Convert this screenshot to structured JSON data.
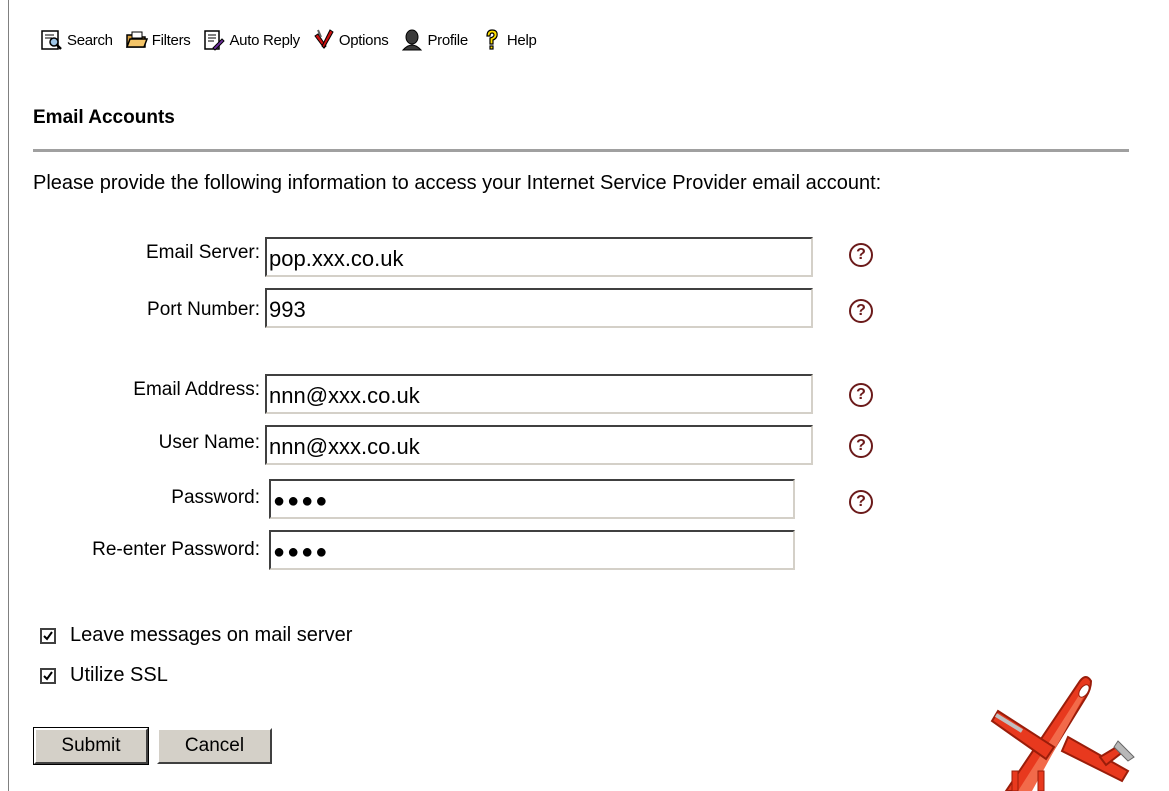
{
  "toolbar": {
    "items": [
      {
        "label": "Search",
        "icon": "search-icon"
      },
      {
        "label": "Filters",
        "icon": "filters-icon"
      },
      {
        "label": "Auto Reply",
        "icon": "auto-reply-icon"
      },
      {
        "label": "Options",
        "icon": "options-icon"
      },
      {
        "label": "Profile",
        "icon": "profile-icon"
      },
      {
        "label": "Help",
        "icon": "help-icon"
      }
    ]
  },
  "section": {
    "title": "Email Accounts",
    "intro": "Please provide the following information to access your Internet Service Provider email account:"
  },
  "form": {
    "email_server": {
      "label": "Email Server:",
      "value": "pop.xxx.co.uk"
    },
    "port_number": {
      "label": "Port Number:",
      "value": "993"
    },
    "email_address": {
      "label": "Email Address:",
      "value": "nnn@xxx.co.uk"
    },
    "user_name": {
      "label": "User Name:",
      "value": "nnn@xxx.co.uk"
    },
    "password": {
      "label": "Password:",
      "value": "●●●●"
    },
    "reenter_password": {
      "label": "Re-enter Password:",
      "value": "●●●●"
    },
    "help_glyph": "?"
  },
  "options": {
    "leave_messages": {
      "label": "Leave messages on mail server",
      "checked": true
    },
    "utilize_ssl": {
      "label": "Utilize SSL",
      "checked": true
    }
  },
  "buttons": {
    "submit": "Submit",
    "cancel": "Cancel"
  },
  "colors": {
    "rule": "#a0a0a0",
    "help_icon": "#6b1a1a",
    "plane_body": "#e8391e",
    "button_face": "#d4d0c8"
  }
}
